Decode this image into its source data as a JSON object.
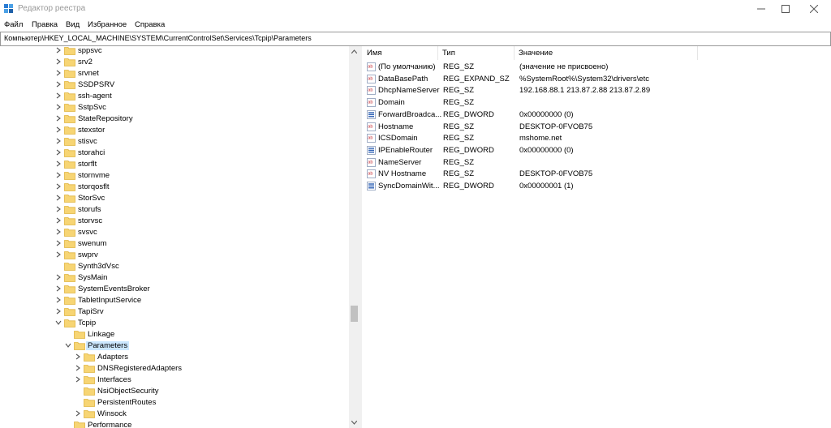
{
  "window": {
    "title": "Редактор реестра",
    "controls": {
      "minimize": "—",
      "maximize": "☐",
      "close": "✕"
    }
  },
  "menu": [
    "Файл",
    "Правка",
    "Вид",
    "Избранное",
    "Справка"
  ],
  "address": "Компьютер\\HKEY_LOCAL_MACHINE\\SYSTEM\\CurrentControlSet\\Services\\Tcpip\\Parameters",
  "tree": {
    "items": [
      {
        "label": "sppsvc",
        "level": 1,
        "expander": "collapsed"
      },
      {
        "label": "srv2",
        "level": 1,
        "expander": "collapsed"
      },
      {
        "label": "srvnet",
        "level": 1,
        "expander": "collapsed"
      },
      {
        "label": "SSDPSRV",
        "level": 1,
        "expander": "collapsed"
      },
      {
        "label": "ssh-agent",
        "level": 1,
        "expander": "collapsed"
      },
      {
        "label": "SstpSvc",
        "level": 1,
        "expander": "collapsed"
      },
      {
        "label": "StateRepository",
        "level": 1,
        "expander": "collapsed"
      },
      {
        "label": "stexstor",
        "level": 1,
        "expander": "collapsed"
      },
      {
        "label": "stisvc",
        "level": 1,
        "expander": "collapsed"
      },
      {
        "label": "storahci",
        "level": 1,
        "expander": "collapsed"
      },
      {
        "label": "storflt",
        "level": 1,
        "expander": "collapsed"
      },
      {
        "label": "stornvme",
        "level": 1,
        "expander": "collapsed"
      },
      {
        "label": "storqosflt",
        "level": 1,
        "expander": "collapsed"
      },
      {
        "label": "StorSvc",
        "level": 1,
        "expander": "collapsed"
      },
      {
        "label": "storufs",
        "level": 1,
        "expander": "collapsed"
      },
      {
        "label": "storvsc",
        "level": 1,
        "expander": "collapsed"
      },
      {
        "label": "svsvc",
        "level": 1,
        "expander": "collapsed"
      },
      {
        "label": "swenum",
        "level": 1,
        "expander": "collapsed"
      },
      {
        "label": "swprv",
        "level": 1,
        "expander": "collapsed"
      },
      {
        "label": "Synth3dVsc",
        "level": 1,
        "expander": "none"
      },
      {
        "label": "SysMain",
        "level": 1,
        "expander": "collapsed"
      },
      {
        "label": "SystemEventsBroker",
        "level": 1,
        "expander": "collapsed"
      },
      {
        "label": "TabletInputService",
        "level": 1,
        "expander": "collapsed"
      },
      {
        "label": "TapiSrv",
        "level": 1,
        "expander": "collapsed"
      },
      {
        "label": "Tcpip",
        "level": 1,
        "expander": "expanded"
      },
      {
        "label": "Linkage",
        "level": 2,
        "expander": "none"
      },
      {
        "label": "Parameters",
        "level": 2,
        "expander": "expanded",
        "selected": true
      },
      {
        "label": "Adapters",
        "level": 3,
        "expander": "collapsed"
      },
      {
        "label": "DNSRegisteredAdapters",
        "level": 3,
        "expander": "collapsed"
      },
      {
        "label": "Interfaces",
        "level": 3,
        "expander": "collapsed"
      },
      {
        "label": "NsiObjectSecurity",
        "level": 3,
        "expander": "none"
      },
      {
        "label": "PersistentRoutes",
        "level": 3,
        "expander": "none"
      },
      {
        "label": "Winsock",
        "level": 3,
        "expander": "collapsed"
      },
      {
        "label": "Performance",
        "level": 2,
        "expander": "none"
      }
    ]
  },
  "list": {
    "columns": [
      "Имя",
      "Тип",
      "Значение"
    ],
    "rows": [
      {
        "icon": "string-value-icon",
        "name": "(По умолчанию)",
        "type": "REG_SZ",
        "value": "(значение не присвоено)"
      },
      {
        "icon": "string-value-icon",
        "name": "DataBasePath",
        "type": "REG_EXPAND_SZ",
        "value": "%SystemRoot%\\System32\\drivers\\etc"
      },
      {
        "icon": "string-value-icon",
        "name": "DhcpNameServer",
        "type": "REG_SZ",
        "value": "192.168.88.1 213.87.2.88 213.87.2.89"
      },
      {
        "icon": "string-value-icon",
        "name": "Domain",
        "type": "REG_SZ",
        "value": ""
      },
      {
        "icon": "dword-value-icon",
        "name": "ForwardBroadca...",
        "type": "REG_DWORD",
        "value": "0x00000000 (0)"
      },
      {
        "icon": "string-value-icon",
        "name": "Hostname",
        "type": "REG_SZ",
        "value": "DESKTOP-0FVOB75"
      },
      {
        "icon": "string-value-icon",
        "name": "ICSDomain",
        "type": "REG_SZ",
        "value": "mshome.net"
      },
      {
        "icon": "dword-value-icon",
        "name": "IPEnableRouter",
        "type": "REG_DWORD",
        "value": "0x00000000 (0)"
      },
      {
        "icon": "string-value-icon",
        "name": "NameServer",
        "type": "REG_SZ",
        "value": ""
      },
      {
        "icon": "string-value-icon",
        "name": "NV Hostname",
        "type": "REG_SZ",
        "value": "DESKTOP-0FVOB75"
      },
      {
        "icon": "dword-value-icon",
        "name": "SyncDomainWit...",
        "type": "REG_DWORD",
        "value": "0x00000001 (1)"
      }
    ]
  },
  "colors": {
    "selection": "#cce8ff",
    "folder": "#f7d574",
    "folder_dark": "#e0b540",
    "icon_blue": "#2b5fb4",
    "icon_red": "#c4262e"
  }
}
